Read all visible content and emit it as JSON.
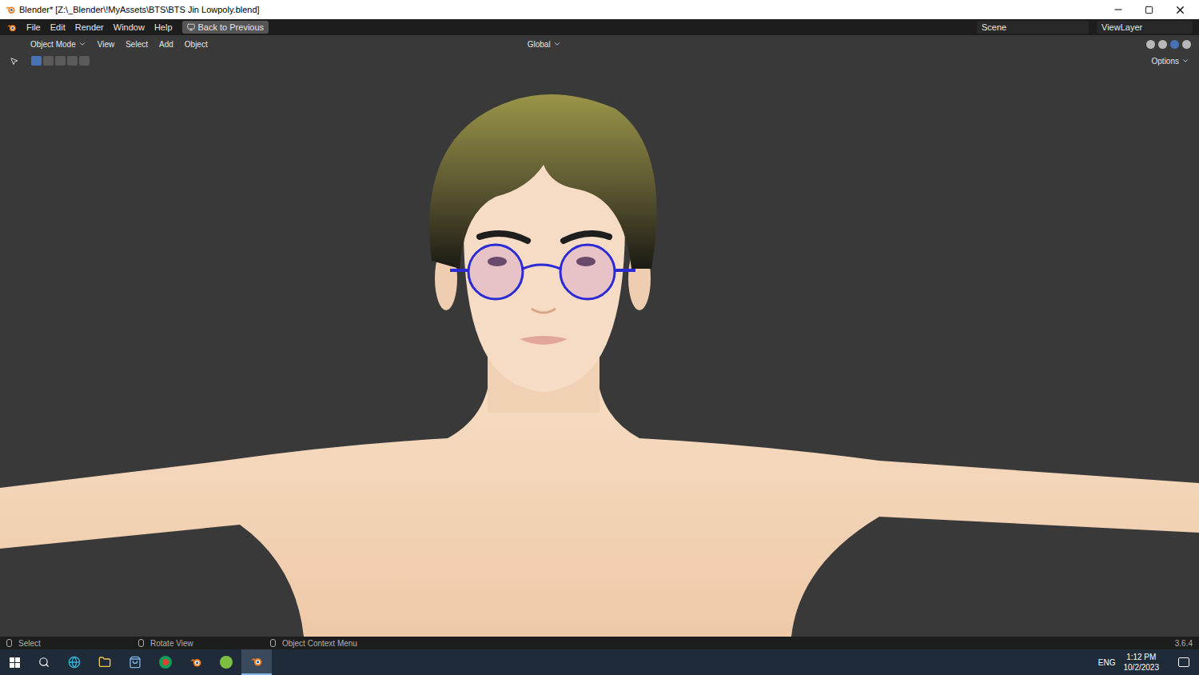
{
  "window": {
    "title": "Blender* [Z:\\_Blender\\!MyAssets\\BTS\\BTS Jin Lowpoly.blend]"
  },
  "top_menu": [
    "File",
    "Edit",
    "Render",
    "Window",
    "Help"
  ],
  "back_button": "Back to Previous",
  "scene": "Scene",
  "view_layer": "ViewLayer",
  "header": {
    "mode": "Object Mode",
    "menus": [
      "View",
      "Select",
      "Add",
      "Object"
    ],
    "orientation": "Global",
    "options": "Options"
  },
  "status_bar": {
    "items": [
      "Select",
      "Rotate View",
      "Object Context Menu"
    ],
    "version": "3.6.4"
  },
  "taskbar": {
    "language": "ENG",
    "time": "1:12 PM",
    "date": "10/2/2023"
  }
}
